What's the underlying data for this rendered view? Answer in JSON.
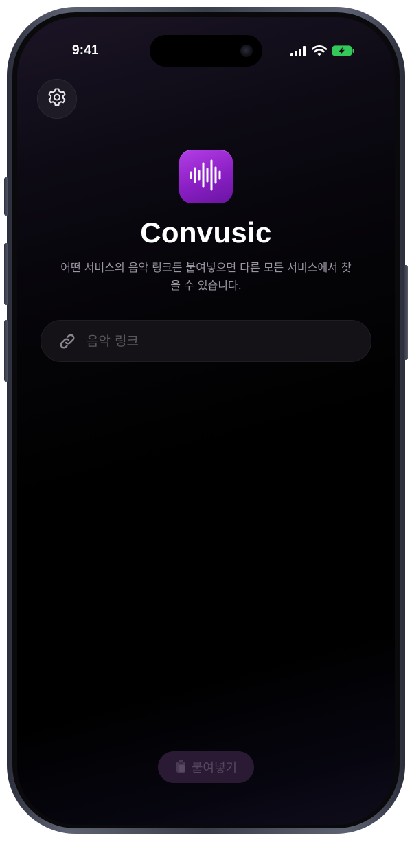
{
  "status_bar": {
    "time": "9:41",
    "icons": [
      "cellular-signal-icon",
      "wifi-icon",
      "battery-charging-icon"
    ],
    "battery_color": "#34c759"
  },
  "settings": {
    "icon": "gear-icon"
  },
  "app": {
    "icon": "sound-wave-icon",
    "accent_color": "#9b2ad6",
    "title": "Convusic",
    "subtitle": "어떤 서비스의 음악 링크든 붙여넣으면 다른 모든 서비스에서 찾을 수 있습니다."
  },
  "link_input": {
    "icon": "link-icon",
    "value": "",
    "placeholder": "음악 링크"
  },
  "paste_button": {
    "icon": "clipboard-icon",
    "label": "붙여넣기"
  }
}
